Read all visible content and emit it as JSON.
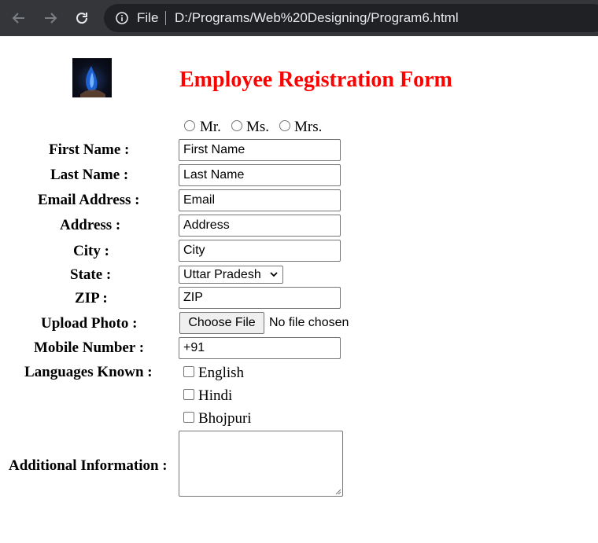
{
  "browser": {
    "scheme_label": "File",
    "url": "D:/Programs/Web%20Designing/Program6.html"
  },
  "page": {
    "title": "Employee Registration Form",
    "title_color": "#ff0000"
  },
  "salutations": [
    "Mr.",
    "Ms.",
    "Mrs."
  ],
  "fields": {
    "first_name": {
      "label": "First Name :",
      "placeholder": "First Name"
    },
    "last_name": {
      "label": "Last Name :",
      "placeholder": "Last Name"
    },
    "email": {
      "label": "Email Address :",
      "placeholder": "Email"
    },
    "address": {
      "label": "Address :",
      "placeholder": "Address"
    },
    "city": {
      "label": "City :",
      "placeholder": "City"
    },
    "state": {
      "label": "State :",
      "value": "Uttar Pradesh"
    },
    "zip": {
      "label": "ZIP :",
      "placeholder": "ZIP"
    },
    "photo": {
      "label": "Upload Photo :",
      "button": "Choose File",
      "status": "No file chosen"
    },
    "mobile": {
      "label": "Mobile Number :",
      "value": "+91"
    },
    "languages": {
      "label": "Languages Known :",
      "options": [
        "English",
        "Hindi",
        "Bhojpuri"
      ]
    },
    "additional": {
      "label": "Additional Information :"
    }
  }
}
